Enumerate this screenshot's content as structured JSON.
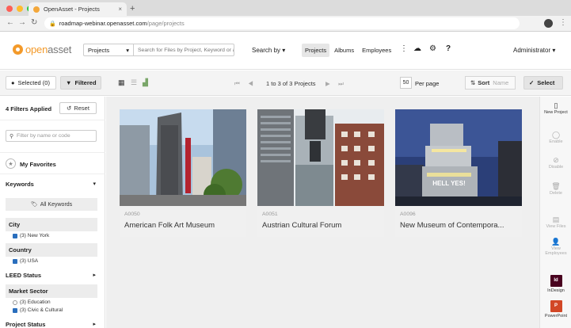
{
  "browser": {
    "tab_title": "OpenAsset - Projects",
    "close_glyph": "×",
    "newtab_glyph": "+",
    "url_domain": "roadmap-webinar.openasset.com",
    "url_path": "/page/projects",
    "traffic_colors": [
      "#fd5f57",
      "#febc2e",
      "#28c840"
    ]
  },
  "header": {
    "logo_text_left": "open",
    "logo_text_right": "asset",
    "search_scope": "Projects",
    "search_placeholder": "Search for Files by Project, Keyword or any...",
    "search_by_label": "Search by ▾",
    "nav_tabs": [
      "Projects",
      "Albums",
      "Employees"
    ],
    "admin_label": "Administrator ▾"
  },
  "toolbar": {
    "selected_label": "Selected (0)",
    "filtered_label": "Filtered",
    "pager_text": "1 to 3 of 3 Projects",
    "per_page_value": "50",
    "per_page_label": "Per page",
    "sort_label": "Sort",
    "sort_value": "Name",
    "select_label": "Select"
  },
  "sidebar": {
    "filters_applied": "4 Filters Applied",
    "reset_label": "Reset",
    "filter_placeholder": "Filter by name or code",
    "favorites_label": "My Favorites",
    "keywords_label": "Keywords",
    "all_keywords_label": "All Keywords",
    "city_label": "City",
    "city_option": "(3) New York",
    "country_label": "Country",
    "country_option": "(3) USA",
    "leed_label": "LEED Status",
    "market_label": "Market Sector",
    "market_options": [
      "(3) Education",
      "(3) Civic & Cultural"
    ],
    "project_status_label": "Project Status"
  },
  "projects": [
    {
      "code": "A0050",
      "name": "American Folk Art Museum"
    },
    {
      "code": "A0051",
      "name": "Austrian Cultural Forum"
    },
    {
      "code": "A0096",
      "name": "New Museum of Contempora..."
    }
  ],
  "rail": {
    "new_project": "New Project",
    "enable": "Enable",
    "disable": "Disable",
    "delete": "Delete",
    "view_files": "View Files",
    "view_employees": "View Employees",
    "indesign": "InDesign",
    "powerpoint": "PowerPoint",
    "indesign_badge": "Id",
    "powerpoint_badge": "P"
  },
  "colors": {
    "brand_orange": "#f39a2a",
    "checkbox_blue": "#2a6ebd",
    "indesign": "#49021f",
    "powerpoint": "#d24726"
  }
}
